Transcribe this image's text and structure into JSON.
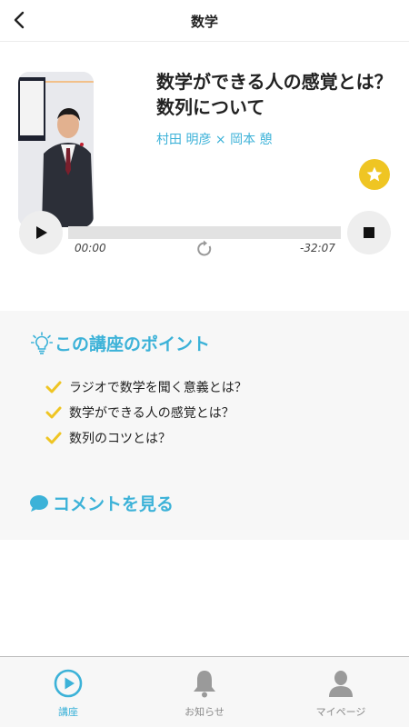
{
  "header": {
    "title": "数学",
    "back_icon": "chevron-left-icon"
  },
  "lecture": {
    "title": "数学ができる人の感覚とは？数列について",
    "authors": "村田 明彦 × 岡本 憩",
    "favorite_icon": "star-icon"
  },
  "player": {
    "current_time": "00:00",
    "remaining_time": "-32:07",
    "progress": 0,
    "play_icon": "play-icon",
    "stop_icon": "stop-icon",
    "reload_icon": "reload-icon"
  },
  "points": {
    "title": "この講座のポイント",
    "icon": "lightbulb-icon",
    "items": [
      "ラジオで数学を聞く意義とは？",
      "数学ができる人の感覚とは？",
      "数列のコツとは？"
    ]
  },
  "comments": {
    "label": "コメントを見る",
    "icon": "speech-bubble-icon"
  },
  "tabbar": {
    "tabs": [
      {
        "label": "講座",
        "icon": "play-circle-icon",
        "active": true
      },
      {
        "label": "お知らせ",
        "icon": "bell-icon",
        "active": false
      },
      {
        "label": "マイページ",
        "icon": "person-icon",
        "active": false
      }
    ]
  },
  "colors": {
    "accent": "#3cb2d8",
    "star": "#efc523",
    "check": "#efc523",
    "inactive": "#8a8a8a"
  }
}
